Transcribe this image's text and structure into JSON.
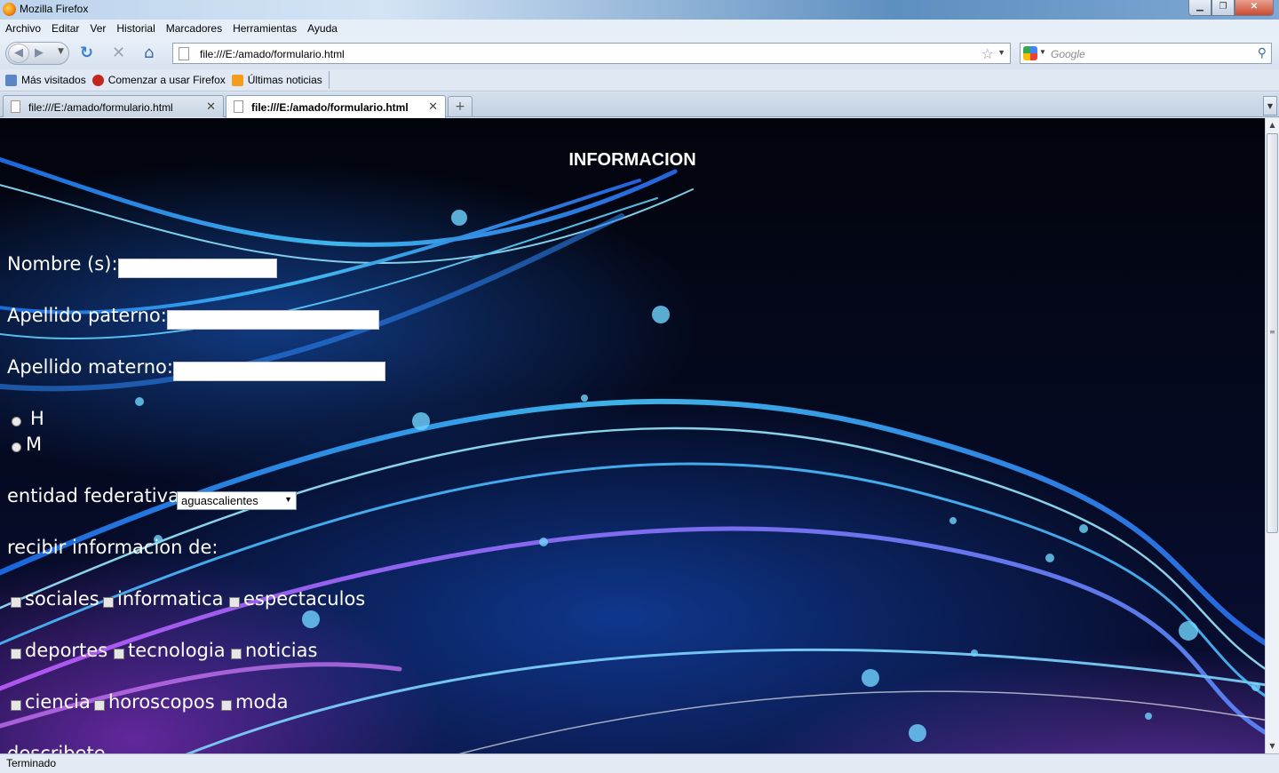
{
  "window": {
    "title": "Mozilla Firefox"
  },
  "menu": {
    "items": [
      "Archivo",
      "Editar",
      "Ver",
      "Historial",
      "Marcadores",
      "Herramientas",
      "Ayuda"
    ]
  },
  "nav": {
    "url": "file:///E:/amado/formulario.html",
    "search_placeholder": "Google"
  },
  "bookmarks": [
    {
      "label": "Más visitados",
      "icon": "most-visited-icon"
    },
    {
      "label": "Comenzar a usar Firefox",
      "icon": "firefox-red-icon"
    },
    {
      "label": "Últimas noticias",
      "icon": "rss-feed-icon"
    }
  ],
  "tabs": [
    {
      "label": "file:///E:/amado/formulario.html",
      "active": false
    },
    {
      "label": "file:///E:/amado/formulario.html",
      "active": true
    }
  ],
  "page": {
    "title": "INFORMACION",
    "nombre_label": "Nombre (s):",
    "apellido_paterno_label": "Apellido paterno:",
    "apellido_materno_label": "Apellido materno:",
    "sexo_h": "H",
    "sexo_m": "M",
    "entidad_label": "entidad federativa",
    "entidad_value": "aguascalientes",
    "recibir_label": "recibir informacion de:",
    "categories": [
      "sociales",
      "informatica",
      "espectaculos",
      "deportes",
      "tecnologia",
      "noticias",
      "ciencia",
      "horoscopos",
      "moda"
    ],
    "partial_label": "describete"
  },
  "status": {
    "text": "Terminado"
  },
  "colors": {
    "page_bg": "#050a22",
    "wave": "#3fa9ff",
    "purple": "#b450ff"
  }
}
